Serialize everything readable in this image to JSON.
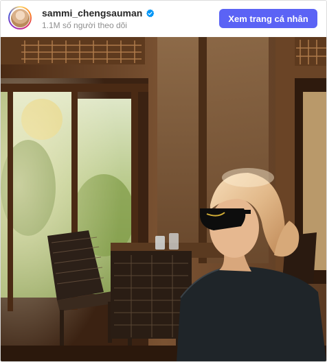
{
  "header": {
    "username": "sammi_chengsauman",
    "followers": "1.1M số người theo dõi",
    "view_profile_label": "Xem trang cá nhân"
  },
  "icons": {
    "verified": "verified-badge-icon"
  },
  "colors": {
    "button": "#5b63f5",
    "verified": "#0095f6"
  }
}
